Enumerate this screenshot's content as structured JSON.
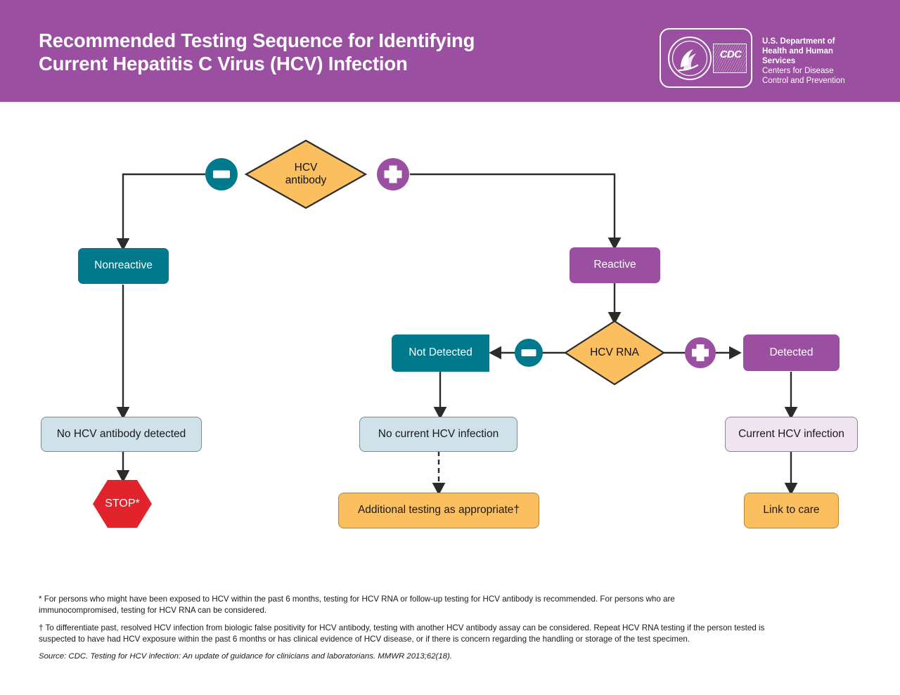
{
  "header": {
    "title_line1": "Recommended Testing Sequence for Identifying",
    "title_line2": "Current Hepatitis C Virus (HCV) Infection",
    "background_color": "#9a4fa0",
    "logo": {
      "cdc_mark": "CDC",
      "agency_line1": "U.S. Department of",
      "agency_line2": "Health and Human Services",
      "agency_line3": "Centers for Disease",
      "agency_line4": "Control and Prevention"
    }
  },
  "diagram": {
    "nodes": {
      "hcv_antibody": {
        "label_line1": "HCV",
        "label_line2": "antibody",
        "shape": "diamond",
        "color": "#fbbf5f"
      },
      "nonreactive": {
        "label": "Nonreactive",
        "shape": "rounded-rect",
        "color": "#00798c"
      },
      "reactive": {
        "label": "Reactive",
        "shape": "rounded-rect",
        "color": "#9a4fa0"
      },
      "no_hcv_antibody_detected": {
        "label": "No HCV antibody detected",
        "shape": "rounded-rect",
        "color": "#cfe2ea"
      },
      "stop": {
        "label": "STOP*",
        "shape": "hexagon",
        "color": "#e1242b"
      },
      "hcv_rna": {
        "label": "HCV RNA",
        "shape": "diamond",
        "color": "#fbbf5f"
      },
      "not_detected": {
        "label": "Not Detected",
        "shape": "rect",
        "color": "#00798c"
      },
      "detected": {
        "label": "Detected",
        "shape": "rounded-rect",
        "color": "#9a4fa0"
      },
      "no_current_hcv_infection": {
        "label": "No current HCV infection",
        "shape": "rounded-rect",
        "color": "#cfe2ea"
      },
      "current_hcv_infection": {
        "label": "Current HCV infection",
        "shape": "rounded-rect",
        "color": "#f0e4f0"
      },
      "additional_testing": {
        "label": "Additional testing as appropriate†",
        "shape": "rounded-rect",
        "color": "#fbbf5f"
      },
      "link_to_care": {
        "label": "Link to care",
        "shape": "rounded-rect",
        "color": "#fbbf5f"
      }
    },
    "signs": {
      "negative_antibody": {
        "symbol": "minus",
        "color": "#00798c"
      },
      "positive_antibody": {
        "symbol": "plus",
        "color": "#9a4fa0"
      },
      "negative_rna": {
        "symbol": "minus",
        "color": "#00798c"
      },
      "positive_rna": {
        "symbol": "plus",
        "color": "#9a4fa0"
      }
    },
    "edges": [
      {
        "from": "hcv_antibody",
        "to": "nonreactive",
        "style": "solid",
        "label": "negative"
      },
      {
        "from": "hcv_antibody",
        "to": "reactive",
        "style": "solid",
        "label": "positive"
      },
      {
        "from": "nonreactive",
        "to": "no_hcv_antibody_detected",
        "style": "solid"
      },
      {
        "from": "no_hcv_antibody_detected",
        "to": "stop",
        "style": "solid"
      },
      {
        "from": "reactive",
        "to": "hcv_rna",
        "style": "solid"
      },
      {
        "from": "hcv_rna",
        "to": "not_detected",
        "style": "solid",
        "label": "negative"
      },
      {
        "from": "hcv_rna",
        "to": "detected",
        "style": "solid",
        "label": "positive"
      },
      {
        "from": "not_detected",
        "to": "no_current_hcv_infection",
        "style": "solid"
      },
      {
        "from": "no_current_hcv_infection",
        "to": "additional_testing",
        "style": "dashed"
      },
      {
        "from": "detected",
        "to": "current_hcv_infection",
        "style": "solid"
      },
      {
        "from": "current_hcv_infection",
        "to": "link_to_care",
        "style": "solid"
      }
    ]
  },
  "footnotes": {
    "star": "* For persons who might have been exposed to HCV within the past 6 months, testing for HCV RNA or follow-up testing for HCV antibody is recommended. For persons who are immunocompromised, testing for HCV RNA can be considered.",
    "dagger": "† To differentiate past, resolved HCV infection from biologic false positivity for HCV antibody, testing with another HCV antibody assay can be considered. Repeat HCV RNA testing if the person tested is suspected to have had HCV exposure within the past 6 months or has clinical evidence of HCV disease, or if there is concern regarding the handling or storage of the test specimen.",
    "source": "Source: CDC. Testing for HCV infection: An update of guidance for clinicians and laboratorians. MMWR 2013;62(18)."
  }
}
